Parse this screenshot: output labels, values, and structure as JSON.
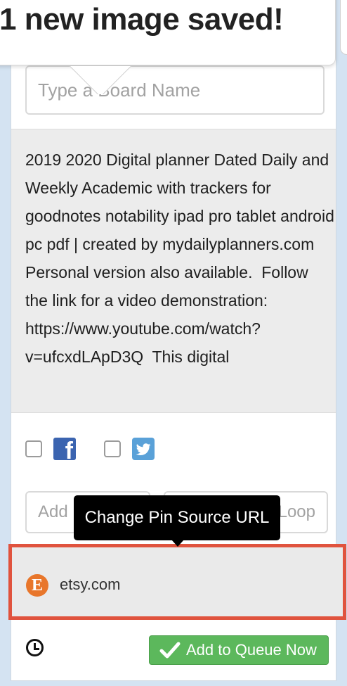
{
  "toast": {
    "message": "1 new image saved!"
  },
  "board": {
    "placeholder": "Type a Board Name"
  },
  "description": {
    "text": "2019 2020 Digital planner Dated Daily and Weekly Academic with trackers for goodnotes notability ipad pro tablet android pc pdf | created by mydailyplanners.com Personal version also available.  Follow the link for a video demonstration: https://www.youtube.com/watch?v=ufcxdLApD3Q  This digital"
  },
  "social": {
    "facebook": {
      "icon": "facebook-icon",
      "color": "#3b64b0",
      "glyph": "f"
    },
    "twitter": {
      "icon": "twitter-icon",
      "color": "#5aa1d8"
    }
  },
  "fields": {
    "left_visible": "Add",
    "right_visible": "Loop"
  },
  "tooltip": {
    "text": "Change Pin Source URL"
  },
  "source": {
    "icon_glyph": "E",
    "domain": "etsy.com",
    "icon_color": "#e8762b",
    "highlight_color": "#e0533e"
  },
  "footer": {
    "queue_button": "Add to Queue Now",
    "button_color": "#5cb85c"
  }
}
